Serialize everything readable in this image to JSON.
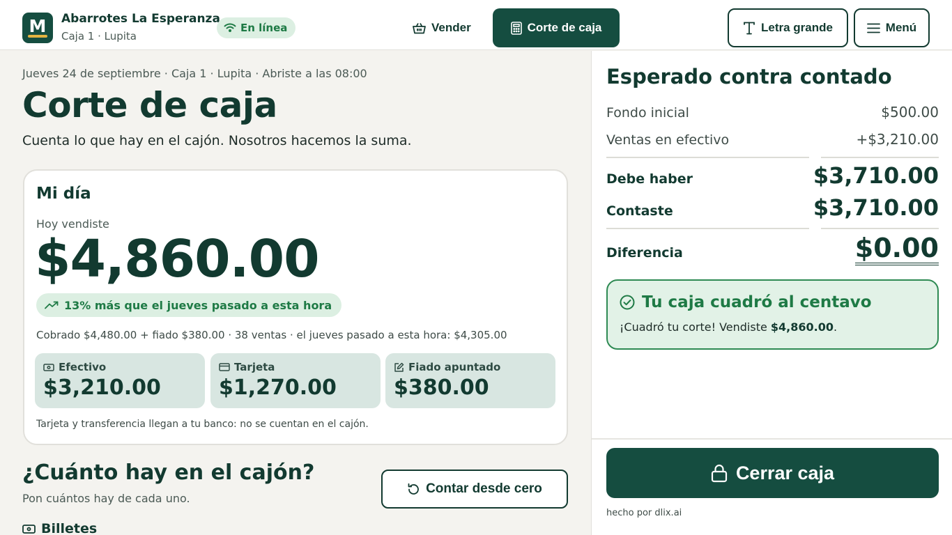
{
  "header": {
    "logo_letter": "M",
    "store_name": "Abarrotes La Esperanza",
    "store_sub": "Caja 1 · Lupita",
    "status": "En línea",
    "nav_sell": "Vender",
    "nav_cut": "Corte de caja",
    "large_text": "Letra grande",
    "menu": "Menú"
  },
  "main": {
    "date_line": "Jueves 24 de septiembre · Caja 1 · Lupita · Abriste a las 08:00",
    "title": "Corte de caja",
    "subtitle": "Cuenta lo que hay en el cajón. Nosotros hacemos la suma.",
    "day_card": {
      "title": "Mi día",
      "today_label": "Hoy vendiste",
      "today_amount": "$4,860.00",
      "trend": "13% más que el jueves pasado a esta hora",
      "summary": "Cobrado $4,480.00 + fiado $380.00 · 38 ventas · el jueves pasado a esta hora: $4,305.00",
      "tiles": [
        {
          "label": "Efectivo",
          "value": "$3,210.00"
        },
        {
          "label": "Tarjeta",
          "value": "$1,270.00"
        },
        {
          "label": "Fiado apuntado",
          "value": "$380.00"
        }
      ],
      "note": "Tarjeta y transferencia llegan a tu banco: no se cuentan en el cajón."
    },
    "drawer": {
      "title": "¿Cuánto hay en el cajón?",
      "subtitle": "Pon cuántos hay de cada uno.",
      "reset": "Contar desde cero",
      "bills": "Billetes"
    }
  },
  "panel": {
    "title": "Esperado contra contado",
    "rows": {
      "opening_label": "Fondo inicial",
      "opening_value": "$500.00",
      "cash_sales_label": "Ventas en efectivo",
      "cash_sales_value": "+$3,210.00",
      "expected_label": "Debe haber",
      "expected_value": "$3,710.00",
      "counted_label": "Contaste",
      "counted_value": "$3,710.00",
      "diff_label": "Diferencia",
      "diff_value": "$0.00"
    },
    "result": {
      "title": "Tu caja cuadró al centavo",
      "text_prefix": "¡Cuadró tu corte! Vendiste ",
      "text_amount": "$4,860.00",
      "text_suffix": "."
    },
    "close_button": "Cerrar caja",
    "credit": "hecho por dlix.ai"
  },
  "colors": {
    "brand": "#154d40",
    "success": "#1e7a45",
    "success_bg": "#e2f2e7",
    "tile_bg": "#d8e6e1",
    "accent": "#e3b341"
  }
}
